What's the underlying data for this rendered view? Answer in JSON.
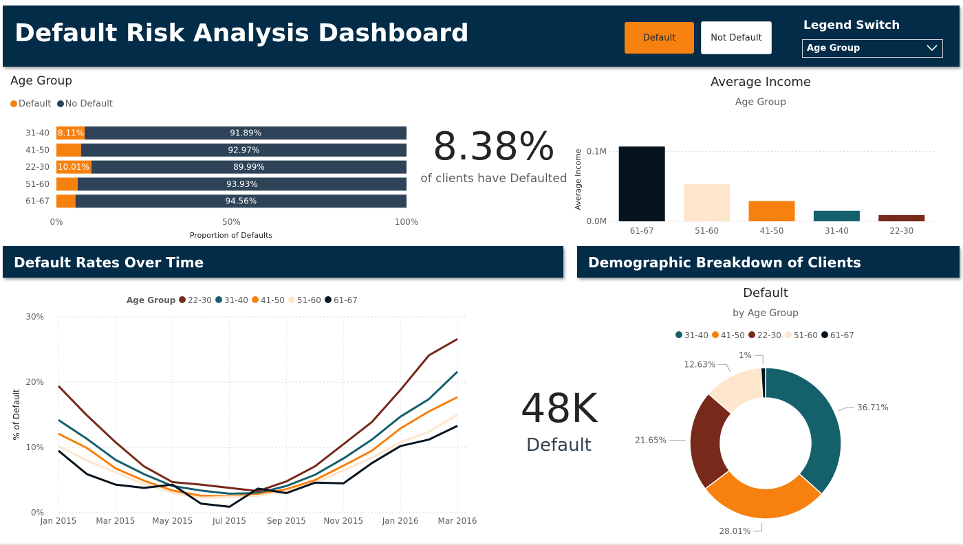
{
  "header": {
    "title": "Default Risk Analysis Dashboard",
    "btn_default": "Default",
    "btn_not_default": "Not Default",
    "legend_switch_label": "Legend Switch",
    "legend_switch_value": "Age Group"
  },
  "colors": {
    "navy": "#022c48",
    "orange": "#f7810f",
    "slate": "#2e4357",
    "teal": "#14606b",
    "brown": "#77291a",
    "cream": "#fde6cc",
    "black": "#06141f"
  },
  "age_bar": {
    "title": "Age Group",
    "legend_default": "Default",
    "legend_no_default": "No Default",
    "xlabel": "Proportion of Defaults",
    "ticks": [
      "0%",
      "50%",
      "100%"
    ],
    "rows": [
      {
        "label": "31-40",
        "default_pct": 8.11,
        "default_text": "8.11%",
        "no_default_text": "91.89%"
      },
      {
        "label": "41-50",
        "default_pct": 7.03,
        "default_text": "",
        "no_default_text": "92.97%"
      },
      {
        "label": "22-30",
        "default_pct": 10.01,
        "default_text": "10.01%",
        "no_default_text": "89.99%"
      },
      {
        "label": "51-60",
        "default_pct": 6.07,
        "default_text": "",
        "no_default_text": "93.93%"
      },
      {
        "label": "61-67",
        "default_pct": 5.44,
        "default_text": "",
        "no_default_text": "94.56%"
      }
    ]
  },
  "kpi_rate": {
    "value": "8.38%",
    "label": "of clients have Defaulted"
  },
  "kpi_count": {
    "value": "48K",
    "label": "Default"
  },
  "income_chart": {
    "title": "Average Income",
    "subtitle": "Age Group",
    "ylabel": "Average Income",
    "yticks": [
      "0.1M",
      "0.0M"
    ]
  },
  "time_section": {
    "title": "Default Rates Over Time"
  },
  "demo_section": {
    "title": "Demographic Breakdown of Clients"
  },
  "time_chart": {
    "legend_title": "Age Group",
    "ylabel": "% of Default",
    "yticks": [
      "30%",
      "20%",
      "10%",
      "0%"
    ],
    "xticks": [
      "Jan 2015",
      "Mar 2015",
      "May 2015",
      "Jul 2015",
      "Sep 2015",
      "Nov 2015",
      "Jan 2016",
      "Mar 2016"
    ]
  },
  "donut": {
    "title": "Default",
    "subtitle": "by Age Group"
  },
  "chart_data": [
    {
      "type": "bar",
      "title": "Average Income",
      "subtitle": "Age Group",
      "ylabel": "Average Income",
      "categories": [
        "61-67",
        "51-60",
        "41-50",
        "31-40",
        "22-30"
      ],
      "values": [
        107000,
        53000,
        29000,
        15000,
        9000
      ],
      "colors": [
        "#06141f",
        "#fde6cc",
        "#f7810f",
        "#14606b",
        "#77291a"
      ],
      "ylim": [
        0,
        120000
      ]
    },
    {
      "type": "line",
      "ylabel": "% of Default",
      "ylim": [
        0,
        30
      ],
      "x": [
        "2015-01",
        "2015-02",
        "2015-03",
        "2015-04",
        "2015-05",
        "2015-06",
        "2015-07",
        "2015-08",
        "2015-09",
        "2015-10",
        "2015-11",
        "2015-12",
        "2016-01",
        "2016-02",
        "2016-03"
      ],
      "legend_position": "top",
      "series": [
        {
          "name": "22-30",
          "color": "#77291a",
          "values": [
            19.4,
            14.9,
            10.8,
            7.1,
            4.7,
            4.3,
            3.8,
            3.3,
            4.8,
            7.1,
            10.5,
            13.9,
            18.8,
            24.1,
            26.6
          ]
        },
        {
          "name": "31-40",
          "color": "#14606b",
          "values": [
            14.2,
            11.3,
            8.1,
            5.9,
            4.1,
            3.4,
            2.9,
            3.0,
            4.1,
            5.8,
            8.3,
            11.2,
            14.7,
            17.4,
            21.6
          ]
        },
        {
          "name": "41-50",
          "color": "#f7810f",
          "values": [
            12.1,
            9.9,
            6.8,
            4.9,
            3.4,
            2.6,
            2.5,
            2.8,
            3.6,
            5.0,
            7.2,
            9.5,
            12.9,
            15.5,
            17.7
          ]
        },
        {
          "name": "51-60",
          "color": "#fde6cc",
          "values": [
            10.2,
            8.0,
            6.2,
            4.4,
            3.0,
            2.3,
            2.4,
            2.6,
            3.3,
            4.6,
            6.5,
            8.4,
            10.8,
            12.4,
            15.0
          ]
        },
        {
          "name": "61-67",
          "color": "#06141f",
          "values": [
            9.5,
            5.9,
            4.3,
            3.8,
            4.3,
            1.4,
            0.9,
            3.7,
            3.0,
            4.6,
            4.5,
            7.6,
            10.2,
            11.2,
            13.3
          ]
        }
      ]
    },
    {
      "type": "pie",
      "title": "Default",
      "subtitle": "by Age Group",
      "slices": [
        {
          "name": "31-40",
          "value": 36.71,
          "label": "36.71%",
          "color": "#14606b"
        },
        {
          "name": "41-50",
          "value": 28.01,
          "label": "28.01%",
          "color": "#f7810f"
        },
        {
          "name": "22-30",
          "value": 21.65,
          "label": "21.65%",
          "color": "#77291a"
        },
        {
          "name": "51-60",
          "value": 12.63,
          "label": "12.63%",
          "color": "#fde6cc"
        },
        {
          "name": "61-67",
          "value": 1.0,
          "label": "1%",
          "color": "#06141f"
        }
      ]
    }
  ]
}
